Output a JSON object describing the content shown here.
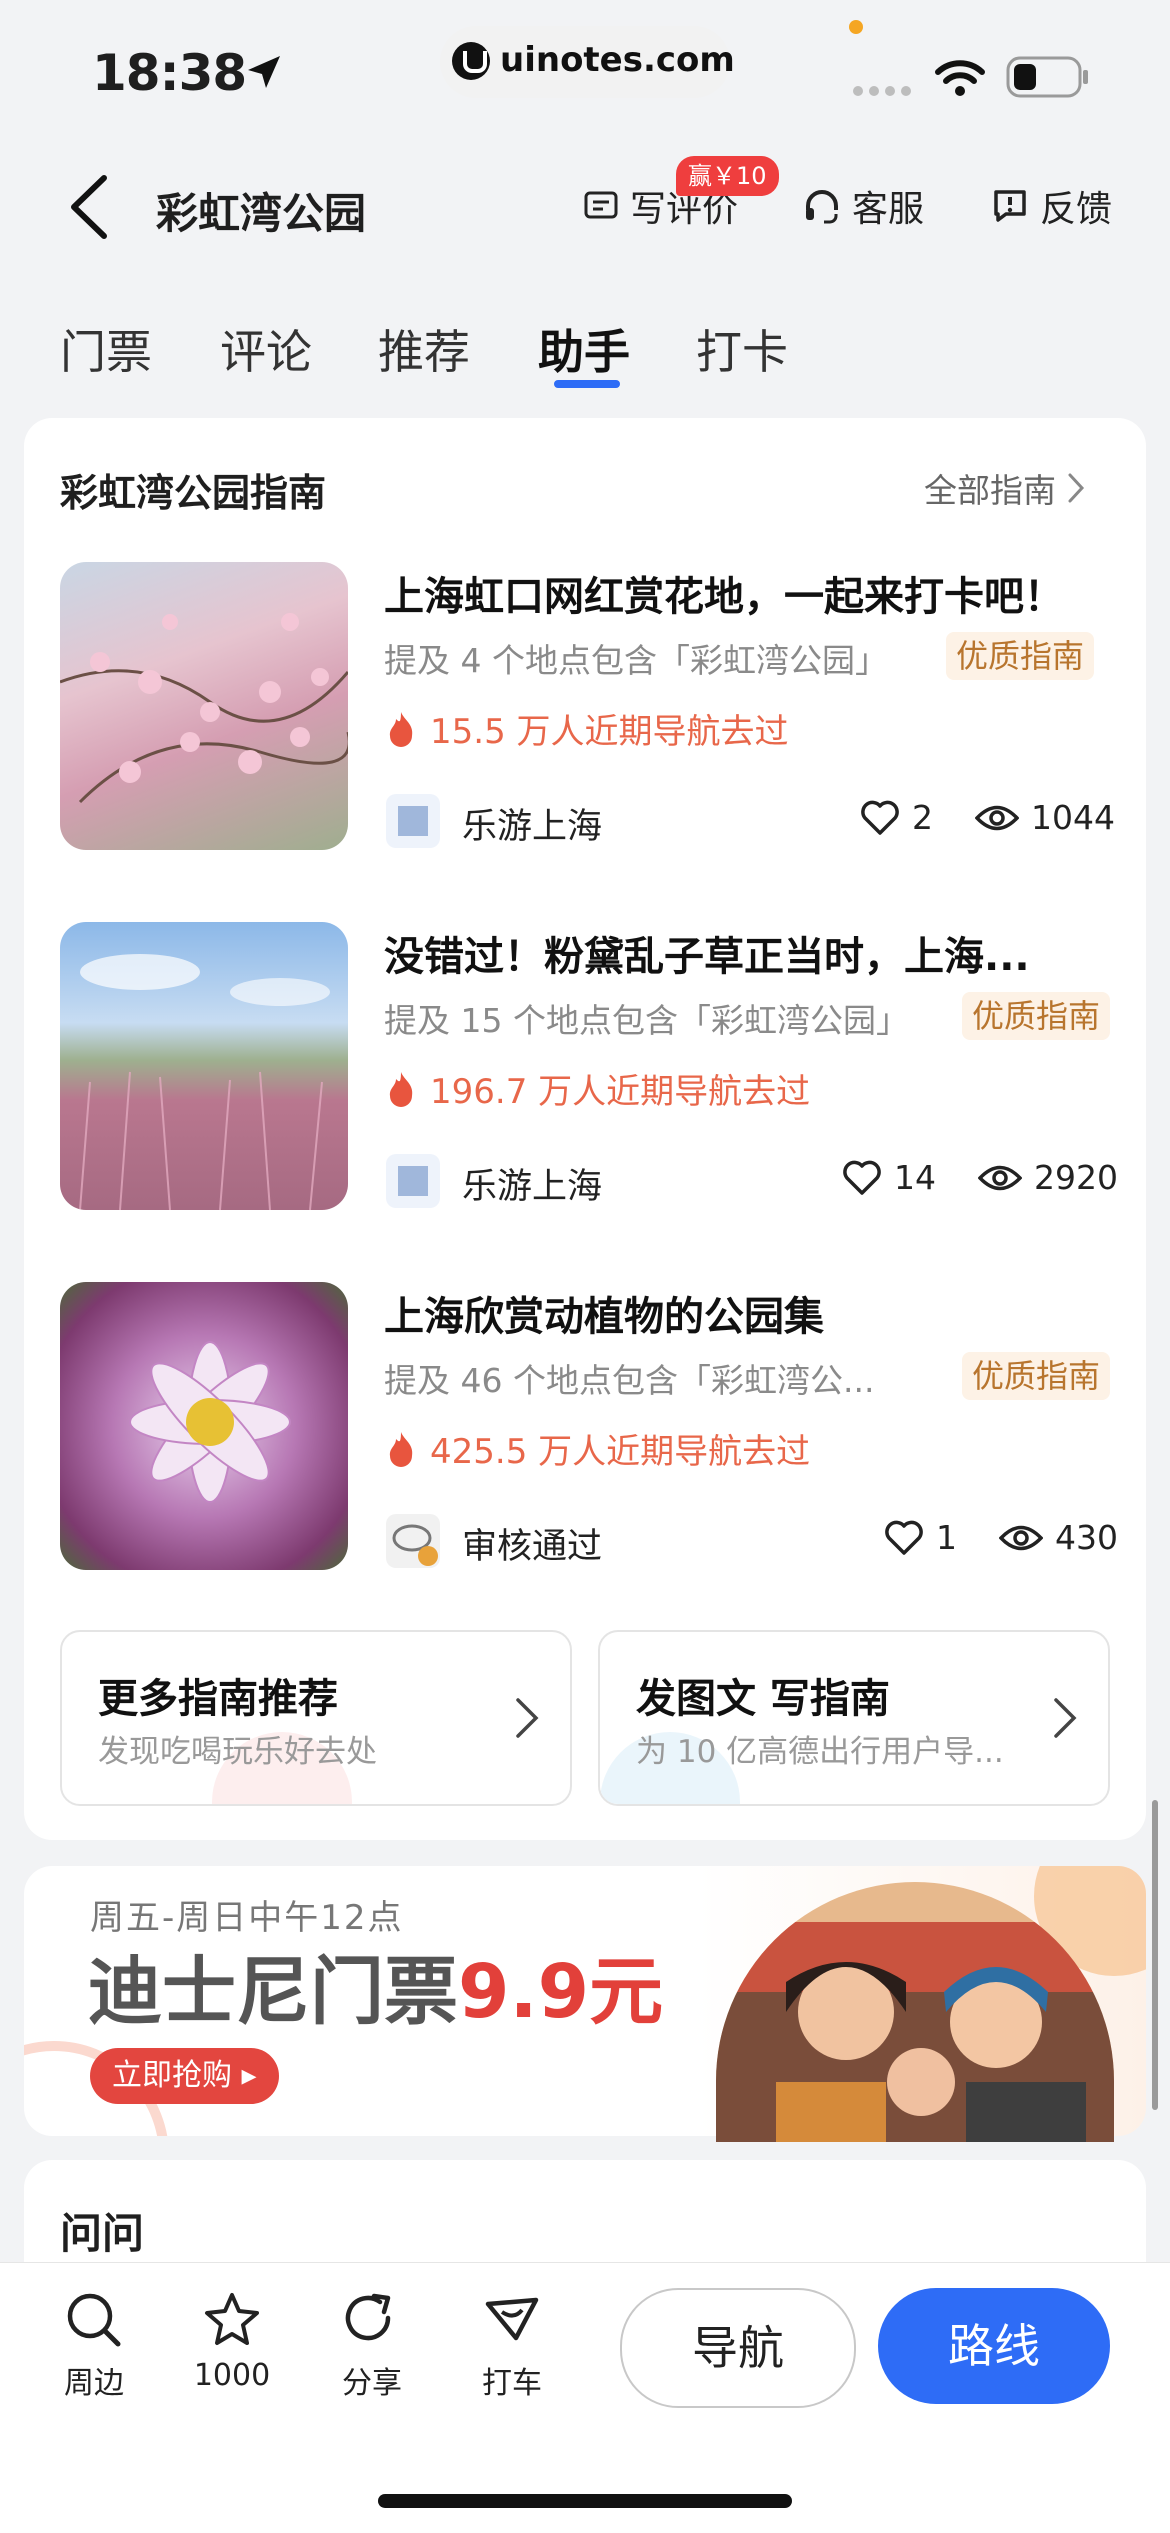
{
  "status_bar": {
    "time": "18:38",
    "url": "uinotes.com"
  },
  "header": {
    "title": "彩虹湾公园",
    "actions": [
      {
        "label": "写评价",
        "icon": "write-review-icon"
      },
      {
        "label": "客服",
        "icon": "headset-icon"
      },
      {
        "label": "反馈",
        "icon": "feedback-icon"
      }
    ],
    "review_badge": "赢￥10"
  },
  "tabs": [
    {
      "label": "门票"
    },
    {
      "label": "评论"
    },
    {
      "label": "推荐"
    },
    {
      "label": "助手",
      "active": true
    },
    {
      "label": "打卡"
    }
  ],
  "guides": {
    "title": "彩虹湾公园指南",
    "all_label": "全部指南",
    "quality_label": "优质指南",
    "items": [
      {
        "title": "上海虹口网红赏花地，一起来打卡吧！",
        "subtitle": "提及 4 个地点包含「彩虹湾公园」",
        "nav": "15.5 万人近期导航去过",
        "author": "乐游上海",
        "likes": "2",
        "views": "1044"
      },
      {
        "title": "没错过！粉黛乱子草正当时，上海...",
        "subtitle": "提及 15 个地点包含「彩虹湾公园」",
        "nav": "196.7 万人近期导航去过",
        "author": "乐游上海",
        "likes": "14",
        "views": "2920"
      },
      {
        "title": "上海欣赏动植物的公园集",
        "subtitle": "提及 46 个地点包含「彩虹湾公...",
        "nav": "425.5 万人近期导航去过",
        "author": "审核通过",
        "likes": "1",
        "views": "430"
      }
    ],
    "more": {
      "title": "更多指南推荐",
      "desc": "发现吃喝玩乐好去处"
    },
    "write": {
      "title": "发图文 写指南",
      "desc": "为 10 亿高德出行用户导..."
    }
  },
  "banner": {
    "top": "周五-周日中午12点",
    "main_prefix": "迪士尼门票",
    "main_price": "9.9元",
    "button": "立即抢购"
  },
  "ask": {
    "title": "问问"
  },
  "bottom_bar": {
    "items": [
      {
        "label": "周边",
        "icon": "search-icon"
      },
      {
        "label": "1000",
        "icon": "star-icon"
      },
      {
        "label": "分享",
        "icon": "share-icon"
      },
      {
        "label": "打车",
        "icon": "taxi-icon"
      }
    ],
    "nav_button": "导航",
    "route_button": "路线"
  },
  "colors": {
    "accent": "#2e6cf6",
    "hot": "#e8674a",
    "badge": "#ef3e3e",
    "quality_bg": "#fdf2e6",
    "quality_text": "#b8752e"
  }
}
